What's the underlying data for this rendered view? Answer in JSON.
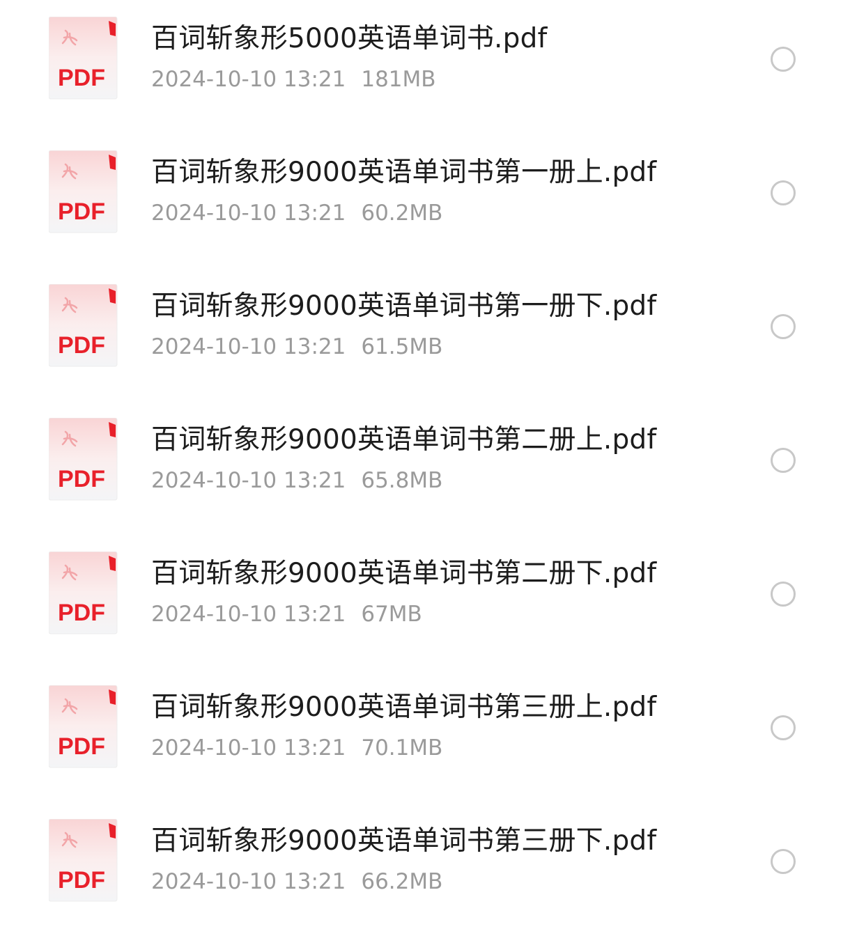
{
  "files": [
    {
      "name": "百词斩象形5000英语单词书.pdf",
      "date": "2024-10-10 13:21",
      "size": "181MB",
      "icon_label": "PDF",
      "icon": "pdf-icon"
    },
    {
      "name": "百词斩象形9000英语单词书第一册上.pdf",
      "date": "2024-10-10 13:21",
      "size": "60.2MB",
      "icon_label": "PDF",
      "icon": "pdf-icon"
    },
    {
      "name": "百词斩象形9000英语单词书第一册下.pdf",
      "date": "2024-10-10 13:21",
      "size": "61.5MB",
      "icon_label": "PDF",
      "icon": "pdf-icon"
    },
    {
      "name": "百词斩象形9000英语单词书第二册上.pdf",
      "date": "2024-10-10 13:21",
      "size": "65.8MB",
      "icon_label": "PDF",
      "icon": "pdf-icon"
    },
    {
      "name": "百词斩象形9000英语单词书第二册下.pdf",
      "date": "2024-10-10 13:21",
      "size": "67MB",
      "icon_label": "PDF",
      "icon": "pdf-icon"
    },
    {
      "name": "百词斩象形9000英语单词书第三册上.pdf",
      "date": "2024-10-10 13:21",
      "size": "70.1MB",
      "icon_label": "PDF",
      "icon": "pdf-icon"
    },
    {
      "name": "百词斩象形9000英语单词书第三册下.pdf",
      "date": "2024-10-10 13:21",
      "size": "66.2MB",
      "icon_label": "PDF",
      "icon": "pdf-icon"
    }
  ],
  "colors": {
    "pdf_red": "#e8202a",
    "name_text": "#1c1c1c",
    "meta_text": "#9a9a9a",
    "radio_border": "#c8c8c8"
  }
}
